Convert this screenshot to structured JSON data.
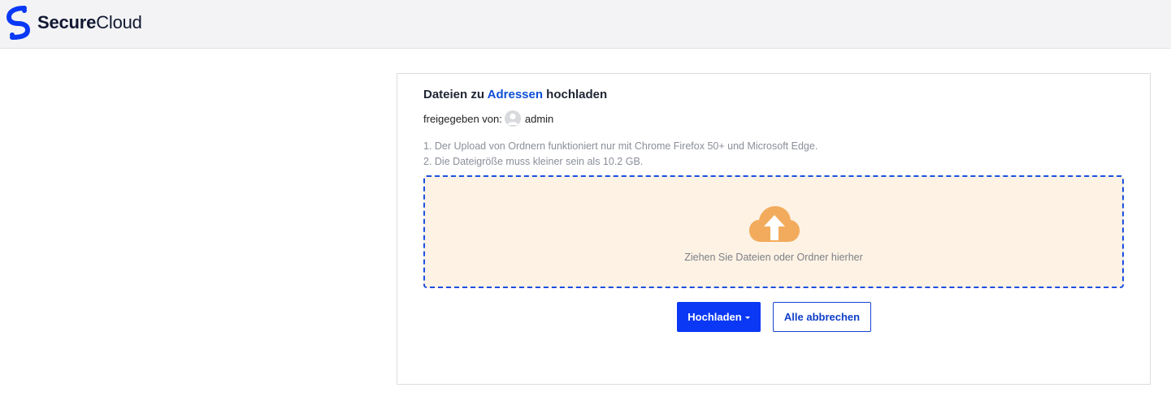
{
  "header": {
    "logo_icon": "securecloud-logo-icon",
    "brand_bold": "Secure",
    "brand_regular": "Cloud",
    "brand_color": "#101832",
    "logo_color": "#0a38f5"
  },
  "upload": {
    "title_prefix": "Dateien zu ",
    "title_link": "Adressen",
    "title_suffix": " hochladen",
    "shared_by_label": "freigegeben von:",
    "avatar_icon": "user-avatar-icon",
    "shared_by_user": "admin",
    "notes": [
      "1. Der Upload von Ordnern funktioniert nur mit Chrome Firefox 50+ und Microsoft Edge.",
      "2. Die Dateigröße muss kleiner sein als 10.2 GB."
    ],
    "dropzone_icon": "cloud-upload-icon",
    "dropzone_text": "Ziehen Sie Dateien oder Ordner hierher",
    "dropzone_color": "#fdf2e4",
    "upload_button": "Hochladen",
    "cancel_button": "Alle abbrechen",
    "accent_color": "#0a38f5",
    "link_color": "#0f4fd6",
    "cloud_color": "#f2ab5c"
  }
}
